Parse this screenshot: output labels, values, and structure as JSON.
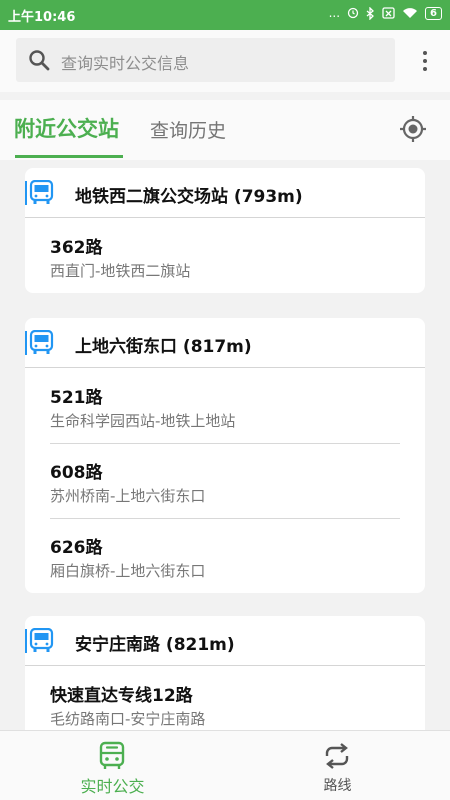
{
  "status_bar": {
    "time": "上午10:46",
    "dots": "...",
    "battery": "6"
  },
  "search": {
    "placeholder": "查询实时公交信息"
  },
  "tabs": {
    "nearby": "附近公交站",
    "history": "查询历史"
  },
  "stations": [
    {
      "name": "地铁西二旗公交场站 (793m)",
      "routes": [
        {
          "name": "362路",
          "direction": "西直门-地铁西二旗站"
        }
      ]
    },
    {
      "name": "上地六街东口 (817m)",
      "routes": [
        {
          "name": "521路",
          "direction": "生命科学园西站-地铁上地站"
        },
        {
          "name": "608路",
          "direction": "苏州桥南-上地六街东口"
        },
        {
          "name": "626路",
          "direction": "厢白旗桥-上地六街东口"
        }
      ]
    },
    {
      "name": "安宁庄南路 (821m)",
      "routes": [
        {
          "name": "快速直达专线12路",
          "direction": "毛纺路南口-安宁庄南路"
        }
      ]
    }
  ],
  "bottom_nav": {
    "realtime": "实时公交",
    "routes": "路线"
  },
  "colors": {
    "accent": "#4caf50",
    "icon_blue": "#2196f3"
  },
  "icons": {
    "search": "search-icon",
    "more": "more-vert-icon",
    "locate": "gps-locate-icon",
    "station": "bus-stop-icon",
    "realtime": "bus-icon",
    "routes": "route-loop-icon"
  }
}
